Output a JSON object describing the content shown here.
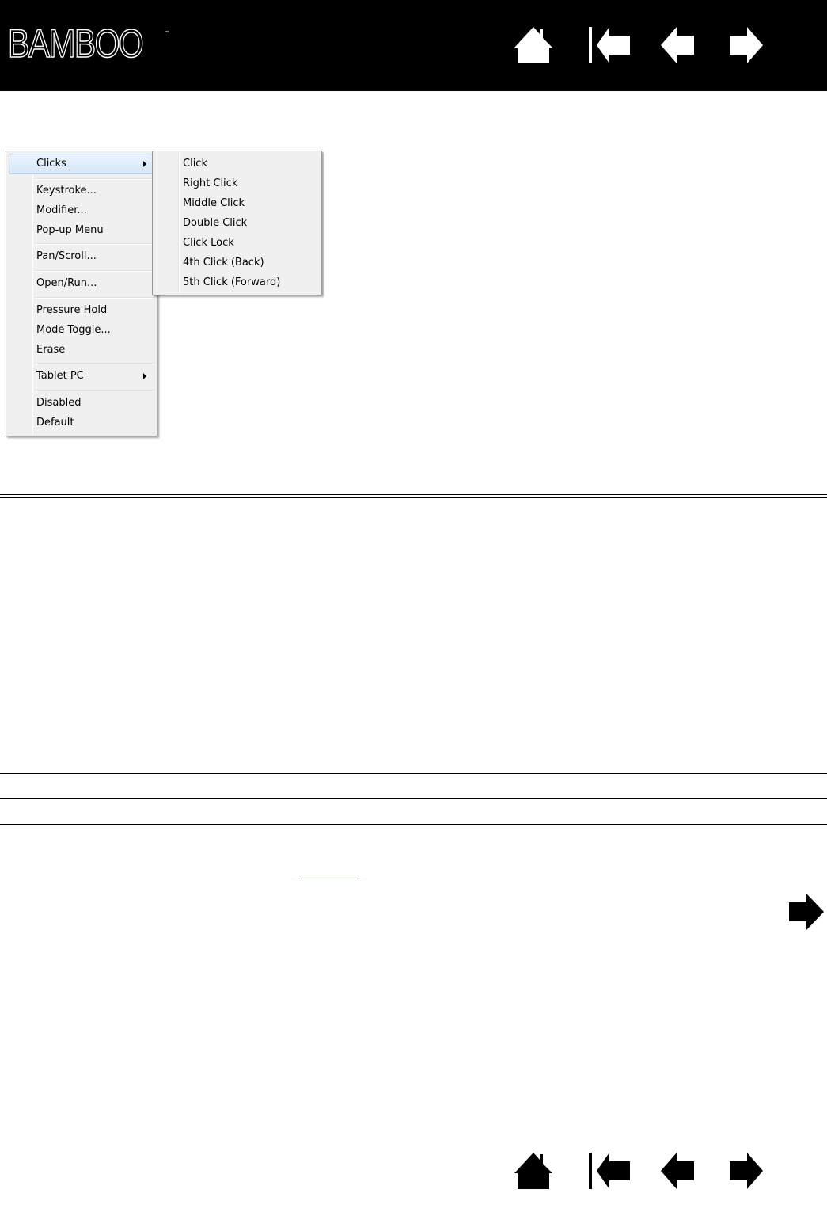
{
  "header": {
    "logo_text": "BAMBOO",
    "logo_tm": "™",
    "nav": [
      "home-icon",
      "first-page-icon",
      "previous-page-icon",
      "next-page-icon"
    ]
  },
  "context_menu": {
    "items": [
      {
        "label": "Clicks",
        "has_submenu": true,
        "highlighted": true
      },
      {
        "label": "Keystroke..."
      },
      {
        "label": "Modifier..."
      },
      {
        "label": "Pop-up Menu"
      },
      {
        "label": "Pan/Scroll..."
      },
      {
        "label": "Open/Run..."
      },
      {
        "label": "Pressure Hold"
      },
      {
        "label": "Mode Toggle..."
      },
      {
        "label": "Erase"
      },
      {
        "label": "Tablet PC",
        "has_submenu": true
      },
      {
        "label": "Disabled"
      },
      {
        "label": "Default"
      }
    ],
    "submenu": [
      "Click",
      "Right Click",
      "Middle Click",
      "Double Click",
      "Click Lock",
      "4th Click (Back)",
      "5th Click (Forward)"
    ]
  },
  "colors": {
    "header_bg": "#000000",
    "link": "#0000cc",
    "highlight": "#d5e7f9"
  }
}
